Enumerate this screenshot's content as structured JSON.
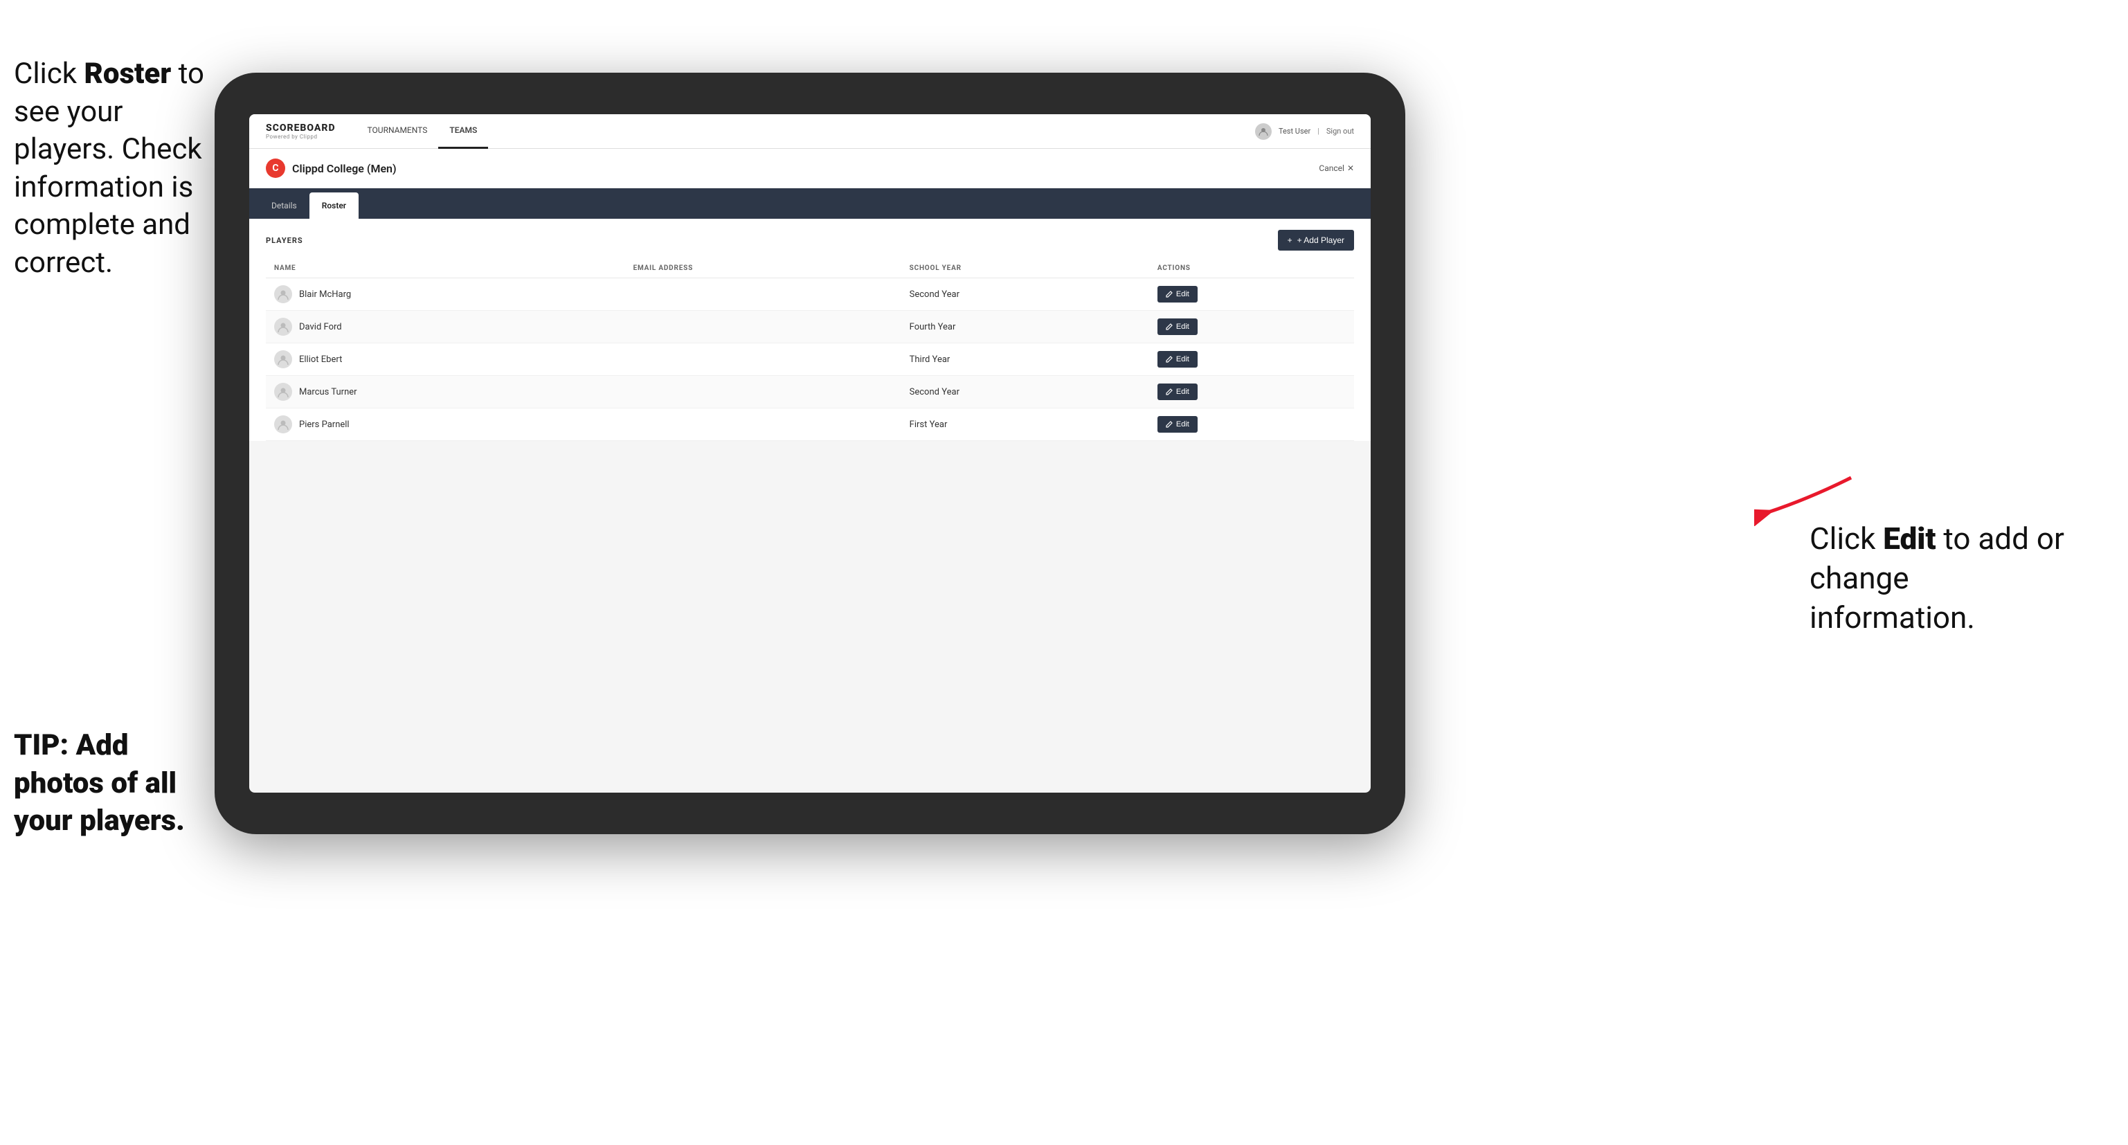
{
  "instructions": {
    "top": {
      "line1": "Click ",
      "bold1": "Roster",
      "line2": " to see your players. Check information is complete and correct."
    },
    "tip": {
      "text": "TIP: Add photos of all your players."
    },
    "right": {
      "line1": "Click ",
      "bold1": "Edit",
      "line2": " to add or change information."
    }
  },
  "app": {
    "logo": "SCOREBOARD",
    "logo_sub": "Powered by Clippd",
    "nav": [
      {
        "label": "TOURNAMENTS",
        "active": false
      },
      {
        "label": "TEAMS",
        "active": true
      }
    ],
    "header_user": "Test User",
    "header_signout": "Sign out"
  },
  "team": {
    "logo_letter": "C",
    "name": "Clippd College (Men)",
    "cancel_label": "Cancel",
    "cancel_x": "✕"
  },
  "tabs": [
    {
      "label": "Details",
      "active": false
    },
    {
      "label": "Roster",
      "active": true
    }
  ],
  "roster": {
    "section_title": "PLAYERS",
    "add_player_label": "+ Add Player",
    "columns": [
      {
        "key": "name",
        "label": "NAME"
      },
      {
        "key": "email",
        "label": "EMAIL ADDRESS"
      },
      {
        "key": "school_year",
        "label": "SCHOOL YEAR"
      },
      {
        "key": "actions",
        "label": "ACTIONS"
      }
    ],
    "players": [
      {
        "name": "Blair McHarg",
        "email": "",
        "school_year": "Second Year"
      },
      {
        "name": "David Ford",
        "email": "",
        "school_year": "Fourth Year"
      },
      {
        "name": "Elliot Ebert",
        "email": "",
        "school_year": "Third Year"
      },
      {
        "name": "Marcus Turner",
        "email": "",
        "school_year": "Second Year"
      },
      {
        "name": "Piers Parnell",
        "email": "",
        "school_year": "First Year"
      }
    ],
    "edit_label": "Edit"
  }
}
